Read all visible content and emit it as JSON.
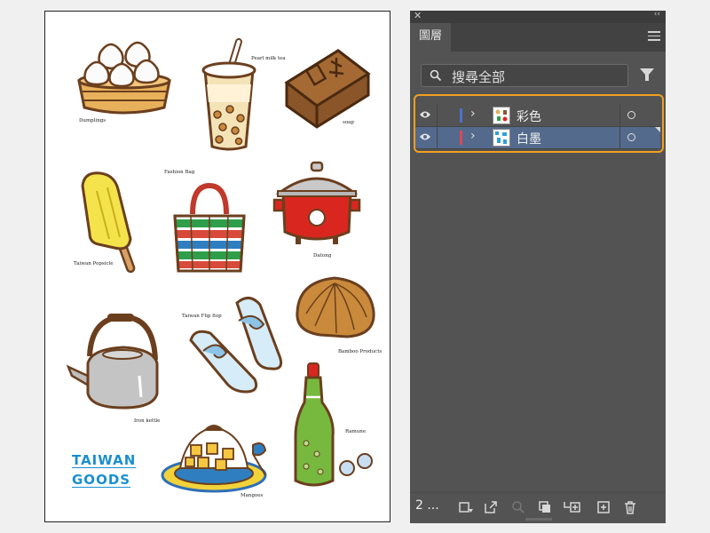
{
  "artboard": {
    "items": [
      {
        "key": "dumplings",
        "label": "Dumplings"
      },
      {
        "key": "milk_tea",
        "label": "Pearl milk tea"
      },
      {
        "key": "soap",
        "label": "soap"
      },
      {
        "key": "fashion_bag",
        "label": "Fashion Bag"
      },
      {
        "key": "popsicle",
        "label": "Taiwan Popsicle"
      },
      {
        "key": "datong",
        "label": "Datong"
      },
      {
        "key": "flipflop",
        "label": "Taiwan Flip flop"
      },
      {
        "key": "bamboo",
        "label": "Bamboo Products"
      },
      {
        "key": "kettle",
        "label": "Iron kettle"
      },
      {
        "key": "ramune",
        "label": "Ramune"
      },
      {
        "key": "mangoes",
        "label": "Mangoes"
      }
    ],
    "brand_line1": "TAIWAN",
    "brand_line2": "GOODS",
    "brand_color": "#1a8fd0"
  },
  "panel": {
    "close_glyph": "✕",
    "collapse_glyph": "‹‹",
    "tab_label": "圖層",
    "search_placeholder": "搜尋全部",
    "layers": [
      {
        "name": "彩色",
        "color": "#4a74c9",
        "selected": false
      },
      {
        "name": "白墨",
        "color": "#d94a56",
        "selected": true
      }
    ],
    "layer_count": "2 ...",
    "highlight_color": "#f0a020",
    "footer_buttons": [
      "collect-for-export",
      "export-selection",
      "locate-object",
      "make-clipping-mask",
      "create-sublayer",
      "create-layer",
      "delete-layer"
    ]
  }
}
